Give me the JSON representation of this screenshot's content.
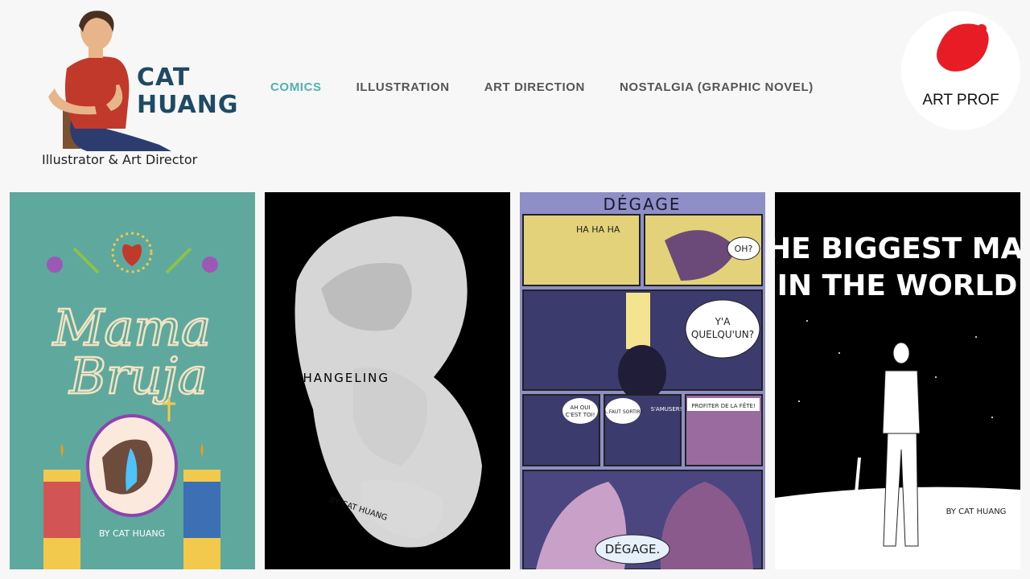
{
  "header": {
    "logo_name_line1": "CAT",
    "logo_name_line2": "HUANG",
    "logo_subtitle": "Illustrator & Art Director",
    "badge_label": "ART PROF"
  },
  "nav": {
    "items": [
      {
        "label": "COMICS",
        "active": true
      },
      {
        "label": "ILLUSTRATION",
        "active": false
      },
      {
        "label": "ART DIRECTION",
        "active": false
      },
      {
        "label": "NOSTALGIA (GRAPHIC NOVEL)",
        "active": false
      }
    ]
  },
  "colors": {
    "accent": "#4fb3ab",
    "nav_text": "#555555",
    "badge_red": "#e81c24"
  },
  "gallery": {
    "cards": [
      {
        "title": "Mama Bruja",
        "byline": "BY CAT HUANG",
        "background": "#5fa89e"
      },
      {
        "title": "CHANGELING",
        "byline": "BY CAT HUANG",
        "background": "#000000"
      },
      {
        "title": "DÉGAGE",
        "byline": "",
        "background": "#8f8fc8",
        "bubbles": [
          "HA HA HA",
          "OH?",
          "Y'A QUELQU'UN?",
          "AH OUI C'EST TOI!",
          "CA VA! IL FAUT SORTIR!",
          "S'AMUSER!",
          "PROFITER DE LA FÊTE!",
          "DÉGAGE."
        ]
      },
      {
        "title_line1": "THE BIGGEST MAN",
        "title_line2": "IN THE WORLD",
        "byline": "BY CAT HUANG",
        "background": "#000000"
      }
    ]
  }
}
